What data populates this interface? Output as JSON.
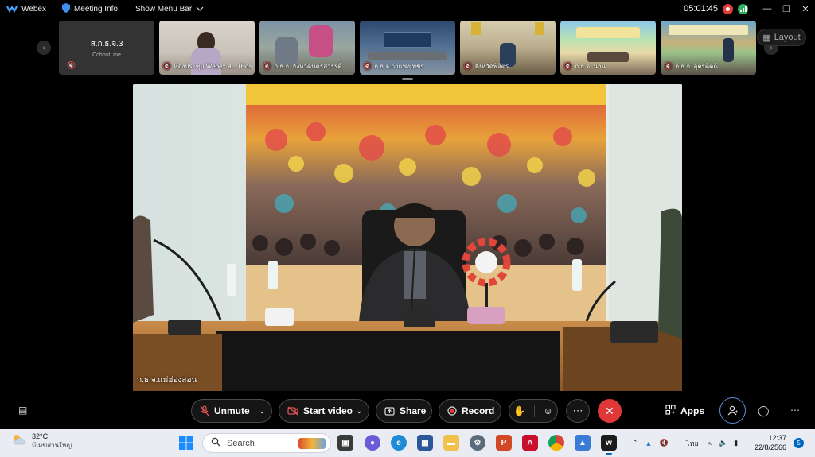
{
  "titlebar": {
    "app_name": "Webex",
    "meeting_info": "Meeting Info",
    "show_menu_bar": "Show Menu Bar",
    "timer": "05:01:45"
  },
  "strip": {
    "layout_label": "Layout",
    "thumbnails": [
      {
        "name": "ส.ก.ธ.จ.3",
        "role": "Cohost, me"
      },
      {
        "name": "ห้องประชุม Webex ส... (Host)"
      },
      {
        "name": "ก.ธ.จ. จังหวัดนครสวรรค์"
      },
      {
        "name": "ก.ธ.จ.กำแพงเพชร"
      },
      {
        "name": "จังหวัดพิจิตร"
      },
      {
        "name": "ก.ธ.จ. น่าน"
      },
      {
        "name": "ก.ธ.จ. อุตรดิตถ์"
      }
    ]
  },
  "stage": {
    "speaker_name": "ก.ธ.จ.แม่ฮ่องสอน"
  },
  "controls": {
    "unmute": "Unmute",
    "start_video": "Start video",
    "share": "Share",
    "record": "Record",
    "apps": "Apps"
  },
  "taskbar": {
    "temperature": "32°C",
    "weather_text": "มีเมฆส่วนใหญ่",
    "search_placeholder": "Search",
    "language": "ไทย",
    "time": "12:37",
    "date": "22/8/2566",
    "notification_count": "5"
  },
  "colors": {
    "record_red": "#e43b3b",
    "leave_red": "#e03838",
    "accent_blue": "#0067c0",
    "signal_green": "#2eb35a"
  }
}
